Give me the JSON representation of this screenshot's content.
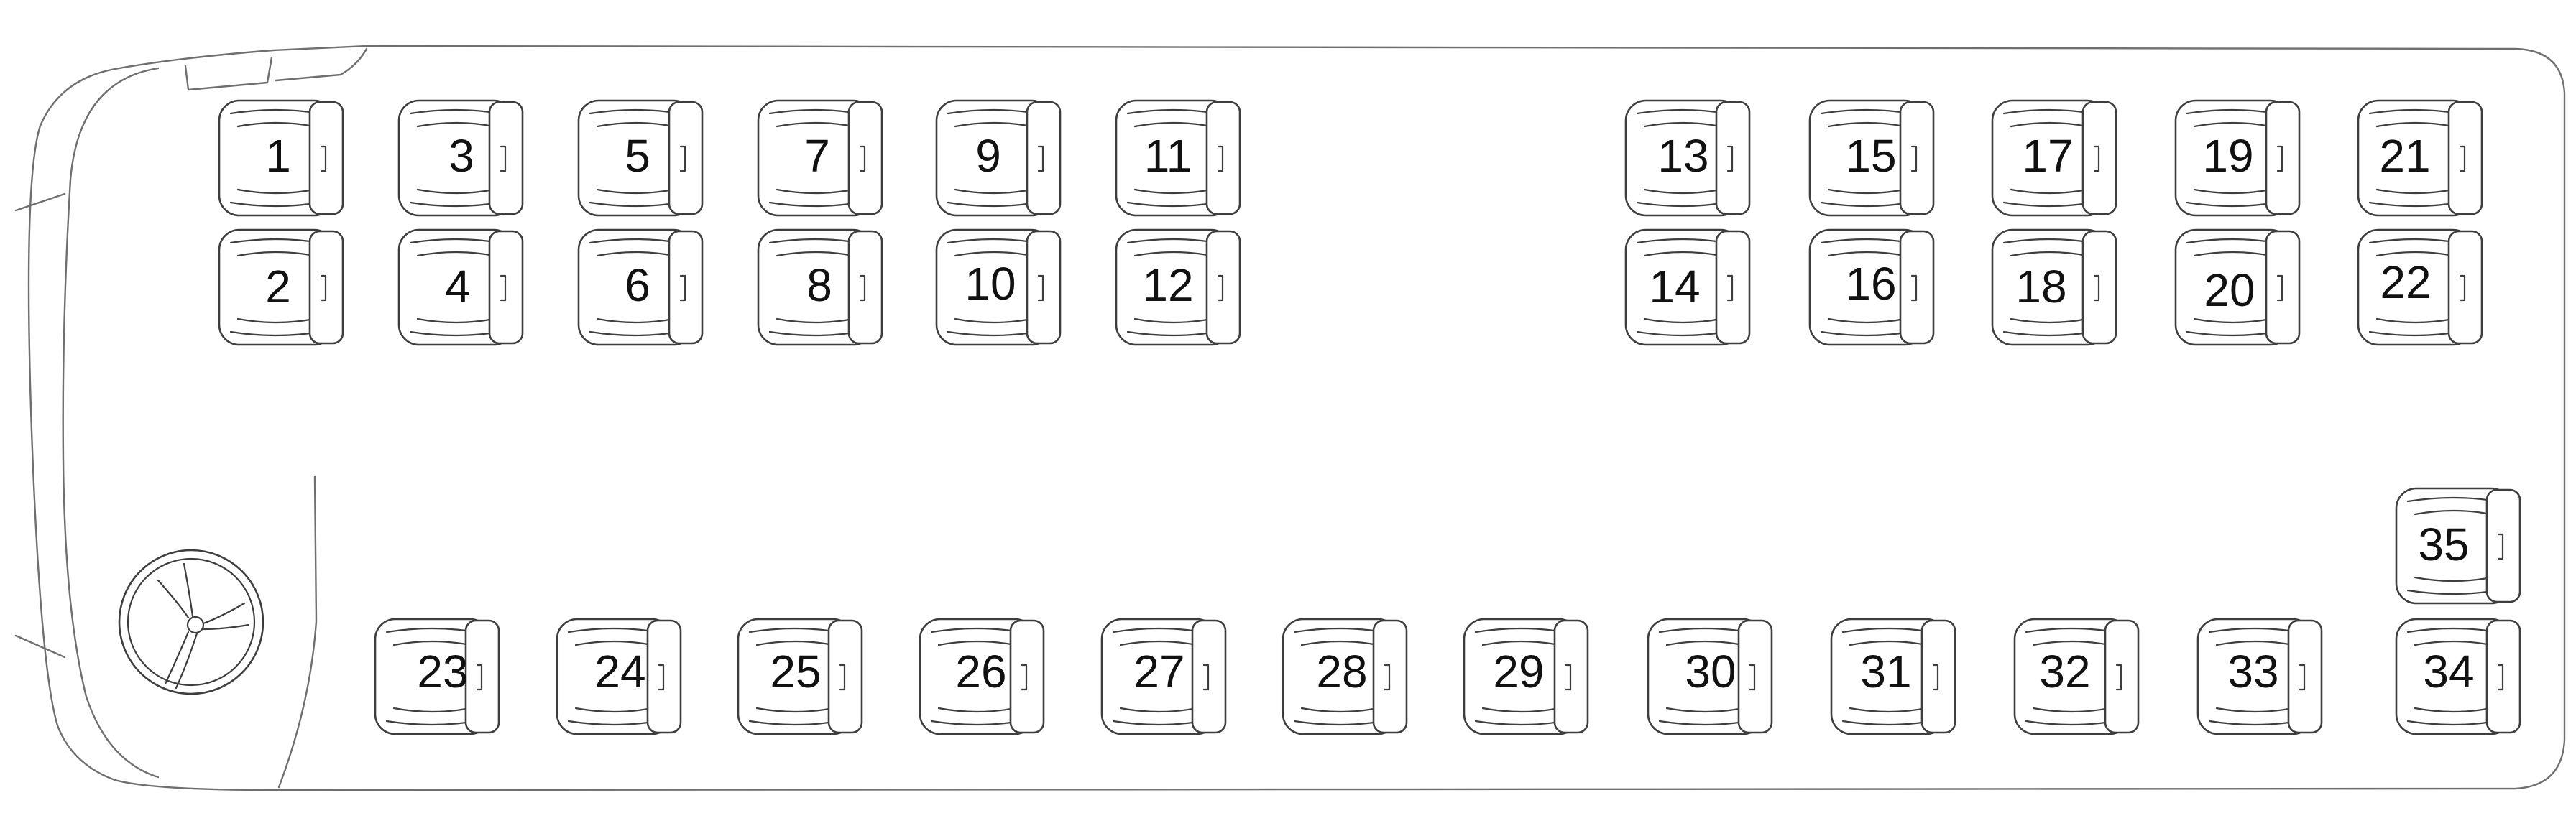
{
  "seat_map": {
    "top_rows": {
      "upper": [
        "1",
        "3",
        "5",
        "7",
        "9",
        "11",
        "13",
        "15",
        "17",
        "19",
        "21"
      ],
      "lower": [
        "2",
        "4",
        "6",
        "8",
        "10",
        "12",
        "14",
        "16",
        "18",
        "20",
        "22"
      ]
    },
    "back_row": [
      "23",
      "24",
      "25",
      "26",
      "27",
      "28",
      "29",
      "30",
      "31",
      "32",
      "33",
      "34"
    ],
    "extra_seat": "35"
  },
  "icons": {
    "steering_wheel": "steering-wheel-icon",
    "seat": "seat-icon"
  },
  "colors": {
    "outline": "#3e3e3e",
    "bus_outline": "#6f6f6f",
    "background": "#ffffff"
  }
}
